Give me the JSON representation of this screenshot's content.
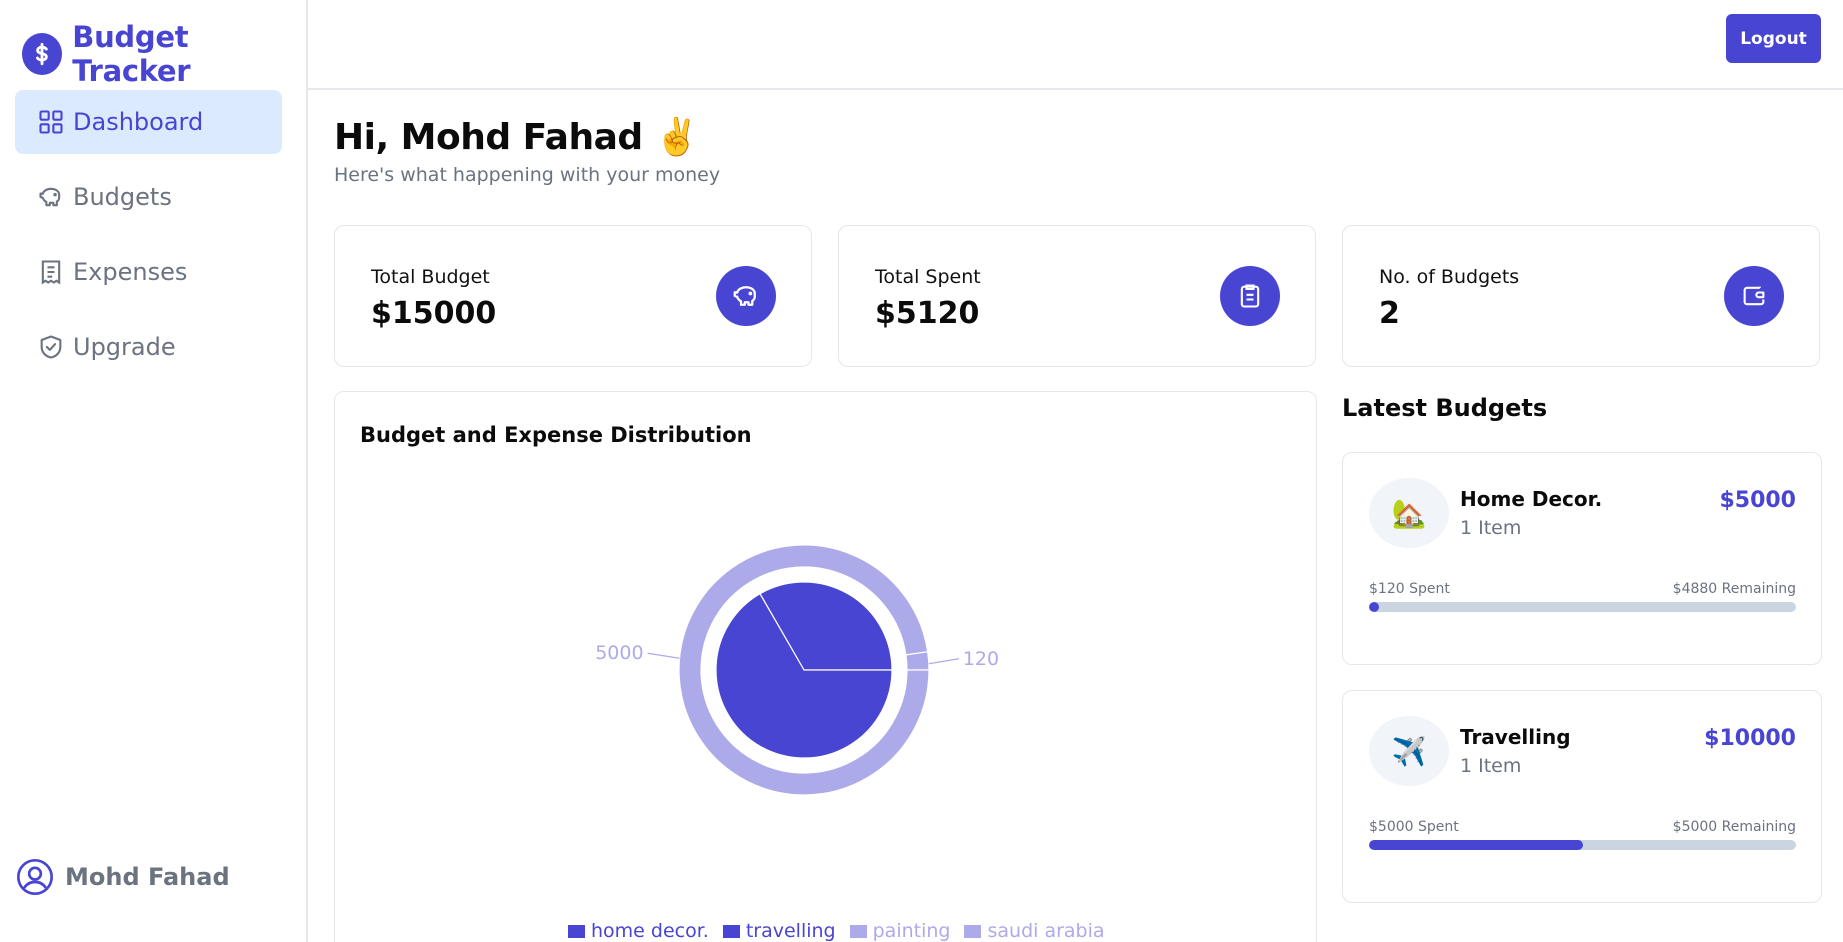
{
  "brand": {
    "name": "Budget Tracker",
    "icon": "dollar-circle-icon",
    "color": "#4845d2"
  },
  "nav": [
    {
      "label": "Dashboard",
      "icon": "grid-icon",
      "active": true
    },
    {
      "label": "Budgets",
      "icon": "piggy-bank-icon",
      "active": false
    },
    {
      "label": "Expenses",
      "icon": "receipt-icon",
      "active": false
    },
    {
      "label": "Upgrade",
      "icon": "shield-check-icon",
      "active": false
    }
  ],
  "user": {
    "name": "Mohd Fahad",
    "icon": "user-circle-icon"
  },
  "topbar": {
    "logout_label": "Logout"
  },
  "greeting": {
    "title": "Hi, Mohd Fahad",
    "emoji": "✌️",
    "subtitle": "Here's what happening with your money"
  },
  "stats": [
    {
      "label": "Total Budget",
      "value": "$15000",
      "icon": "piggy-bank-icon"
    },
    {
      "label": "Total Spent",
      "value": "$5120",
      "icon": "receipt-icon"
    },
    {
      "label": "No. of Budgets",
      "value": "2",
      "icon": "wallet-icon"
    }
  ],
  "chart": {
    "title": "Budget and Expense Distribution"
  },
  "chart_data": {
    "type": "pie",
    "title": "Budget and Expense Distribution",
    "series": [
      {
        "name": "inner",
        "slices": [
          {
            "label": "home decor.",
            "value": 5000
          },
          {
            "label": "travelling",
            "value": 10000
          }
        ]
      },
      {
        "name": "outer",
        "slices": [
          {
            "label": "painting",
            "value": 120
          },
          {
            "label": "saudi arabia",
            "value": 5000
          }
        ]
      }
    ],
    "data_labels": [
      "5000",
      "120"
    ],
    "legend": [
      "home decor.",
      "travelling",
      "painting",
      "saudi arabia"
    ],
    "legend_placement": "bottom",
    "colors": {
      "inner": "#4845d2",
      "outer": "#adaaea"
    }
  },
  "latest": {
    "title": "Latest Budgets",
    "items": [
      {
        "name": "Home Decor.",
        "emoji": "🏡",
        "items": "1 Item",
        "amount": "$5000",
        "spent": "$120 Spent",
        "remaining": "$4880 Remaining",
        "progress": 0.024
      },
      {
        "name": "Travelling",
        "emoji": "✈️",
        "items": "1 Item",
        "amount": "$10000",
        "spent": "$5000 Spent",
        "remaining": "$5000 Remaining",
        "progress": 0.5
      }
    ]
  }
}
